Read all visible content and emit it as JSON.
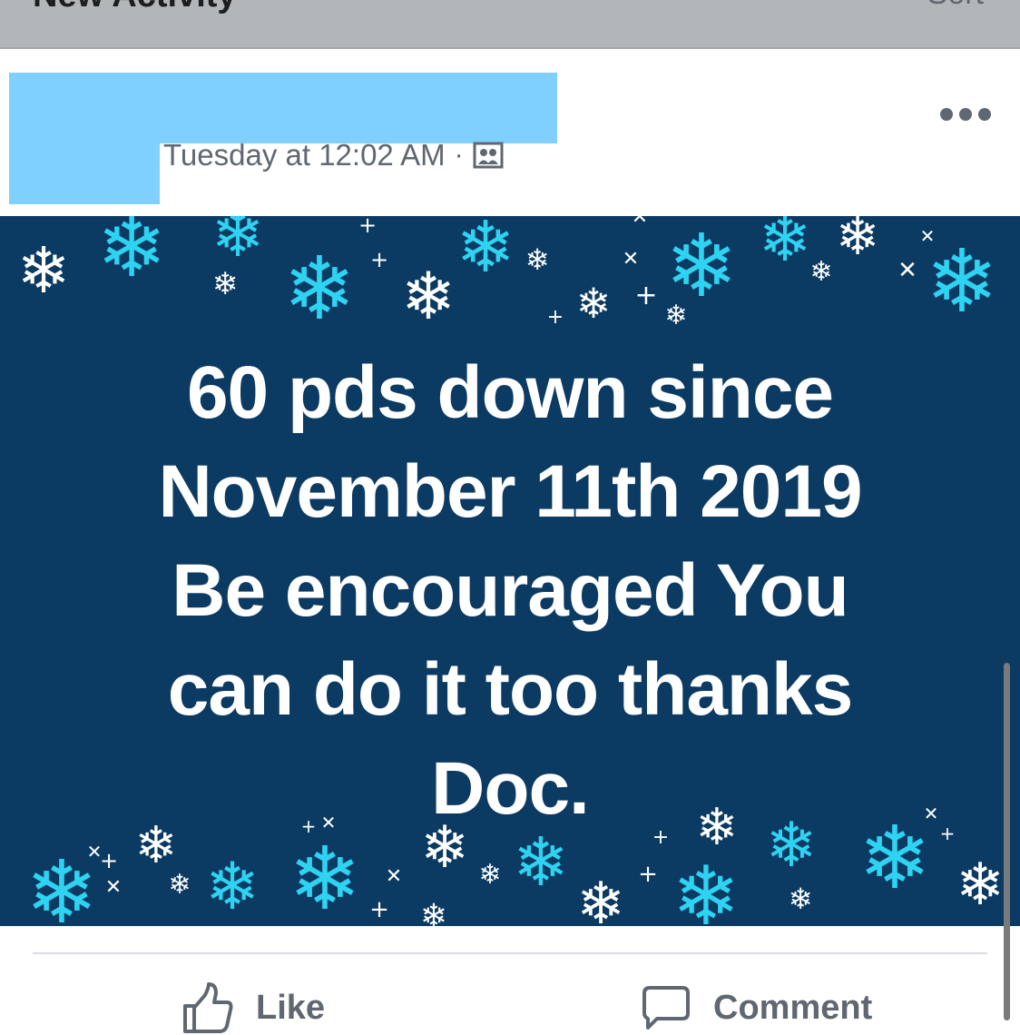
{
  "header": {
    "title": "New Activity",
    "sort_label": "Sort"
  },
  "post": {
    "timestamp": "Tuesday at 12:02 AM",
    "separator": "·",
    "audience_icon": "group-icon",
    "image_text": [
      "60 pds down since",
      "November 11th 2019",
      "Be encouraged You",
      "can do it too thanks",
      "Doc."
    ],
    "image_colors": {
      "background": "#0b3a63",
      "flake_cyan": "#2ed3f2",
      "flake_white": "#ffffff"
    }
  },
  "actions": {
    "like_label": "Like",
    "comment_label": "Comment"
  }
}
